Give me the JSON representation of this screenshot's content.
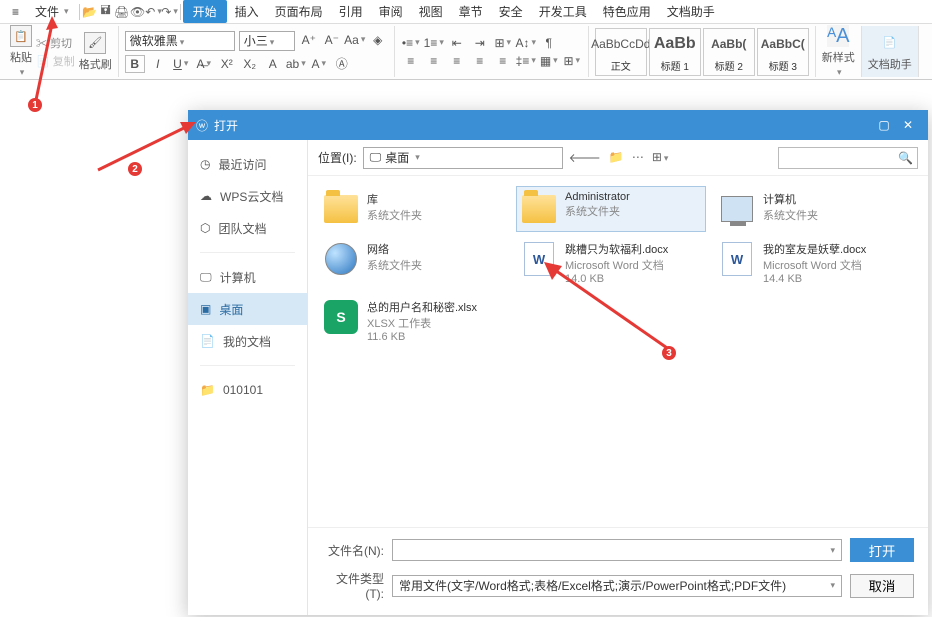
{
  "menubar": {
    "file": "文件",
    "tabs": [
      "开始",
      "插入",
      "页面布局",
      "引用",
      "审阅",
      "视图",
      "章节",
      "安全",
      "开发工具",
      "特色应用",
      "文档助手"
    ]
  },
  "ribbon": {
    "paste": "粘贴",
    "cut": "剪切",
    "copy": "复制",
    "format_painter": "格式刷",
    "font_name": "微软雅黑",
    "font_size": "小三",
    "styles": [
      {
        "preview": "AaBbCcDd",
        "label": "正文"
      },
      {
        "preview": "AaBb",
        "label": "标题 1"
      },
      {
        "preview": "AaBb(",
        "label": "标题 2"
      },
      {
        "preview": "AaBbC(",
        "label": "标题 3"
      }
    ],
    "new_style": "新样式",
    "doc_assist": "文档助手"
  },
  "dialog": {
    "title": "打开",
    "sidebar": [
      {
        "icon": "clock",
        "label": "最近访问"
      },
      {
        "icon": "cloud",
        "label": "WPS云文档"
      },
      {
        "icon": "team",
        "label": "团队文档"
      },
      {
        "icon": "pc",
        "label": "计算机"
      },
      {
        "icon": "desktop",
        "label": "桌面"
      },
      {
        "icon": "doc",
        "label": "我的文档"
      },
      {
        "icon": "folder",
        "label": "010101"
      }
    ],
    "location_label": "位置(I):",
    "location_value": "桌面",
    "items": [
      {
        "type": "lib",
        "name": "库",
        "sub": "系统文件夹"
      },
      {
        "type": "user",
        "name": "Administrator",
        "sub": "系统文件夹",
        "selected": true
      },
      {
        "type": "pc",
        "name": "计算机",
        "sub": "系统文件夹"
      },
      {
        "type": "net",
        "name": "网络",
        "sub": "系统文件夹"
      },
      {
        "type": "word",
        "name": "跳槽只为软福利.docx",
        "sub": "Microsoft Word 文档",
        "size": "14.0 KB"
      },
      {
        "type": "word",
        "name": "我的室友是妖孽.docx",
        "sub": "Microsoft Word 文档",
        "size": "14.4 KB"
      },
      {
        "type": "xlsx",
        "name": "总的用户名和秘密.xlsx",
        "sub": "XLSX 工作表",
        "size": "11.6 KB"
      }
    ],
    "filename_label": "文件名(N):",
    "filename_value": "",
    "filetype_label": "文件类型(T):",
    "filetype_value": "常用文件(文字/Word格式;表格/Excel格式;演示/PowerPoint格式;PDF文件)",
    "open_btn": "打开",
    "cancel_btn": "取消"
  },
  "annotations": {
    "b1": "1",
    "b2": "2",
    "b3": "3"
  }
}
